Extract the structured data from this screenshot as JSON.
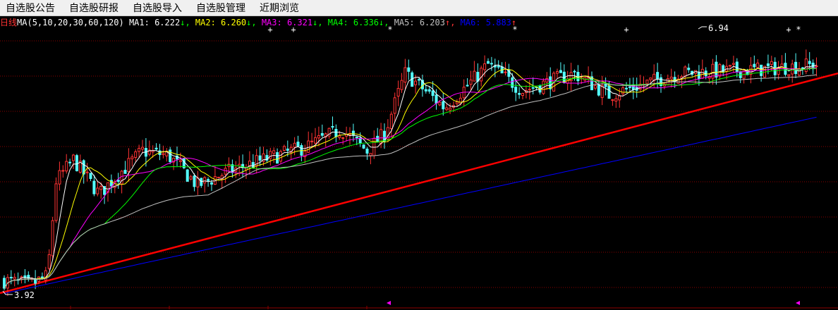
{
  "menu": {
    "items": [
      "自选股公告",
      "自选股研报",
      "自选股导入",
      "自选股管理",
      "近期浏览"
    ]
  },
  "legend": {
    "period_label": "日线",
    "ma_params": "MA(5,10,20,30,60,120)",
    "items": [
      {
        "name": "MA1",
        "value": "6.222",
        "arrow": "↓",
        "color": "#ffffff"
      },
      {
        "name": "MA2",
        "value": "6.260",
        "arrow": "↓",
        "color": "#ffff00"
      },
      {
        "name": "MA3",
        "value": "6.321",
        "arrow": "↓",
        "color": "#ff00ff"
      },
      {
        "name": "MA4",
        "value": "6.336",
        "arrow": "↓",
        "color": "#00ff00"
      },
      {
        "name": "MA5",
        "value": "6.203",
        "arrow": "↑",
        "color": "#c0c0c0"
      },
      {
        "name": "MA6",
        "value": "5.883",
        "arrow": "↑",
        "color": "#0000ff"
      }
    ],
    "down_arrow_color": "#00ff00",
    "up_arrow_color": "#ff3333",
    "period_color": "#ff3333",
    "params_color": "#ffffff"
  },
  "chart_data": {
    "type": "candlestick",
    "annotations": {
      "high": "6.94",
      "low": "3.92"
    },
    "price_range": [
      3.92,
      6.94
    ],
    "markers_top": [
      "+",
      "+",
      "*",
      "*",
      "+",
      "+",
      "*"
    ],
    "trendline_color": "#ff0000",
    "colors": {
      "up": "#ff3333",
      "down": "#54ffff",
      "grid": "#8b0000",
      "background": "#000000",
      "marker": "#ff00ff"
    },
    "notes": "Candlestick daily chart with moving averages MA5/MA10/MA20/MA30/MA60/MA120 and an ascending red support trendline."
  }
}
